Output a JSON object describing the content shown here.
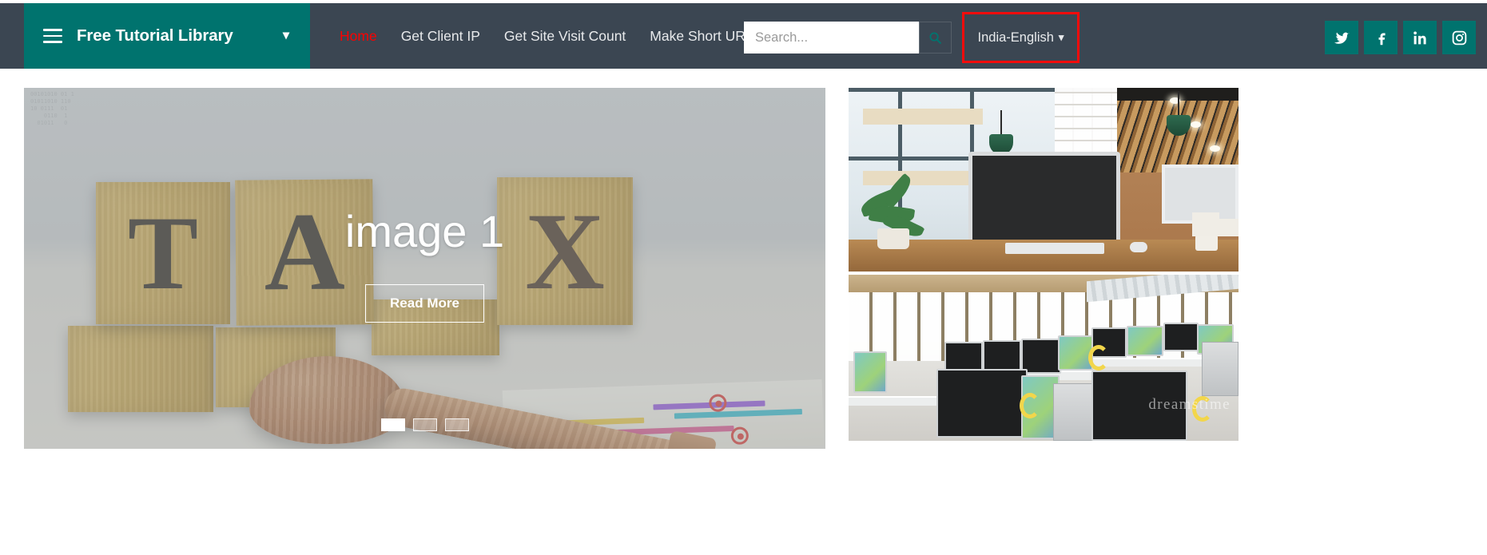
{
  "brand": {
    "title": "Free Tutorial Library",
    "menu_icon": "hamburger-icon",
    "caret_icon": "chevron-down-icon",
    "bg_color": "#00736e"
  },
  "header": {
    "bg_color": "#3b4652",
    "nav": [
      {
        "label": "Home",
        "active": true,
        "color": "#fb0000"
      },
      {
        "label": "Get Client IP",
        "active": false
      },
      {
        "label": "Get Site Visit Count",
        "active": false
      },
      {
        "label": "Make Short URL",
        "active": false
      }
    ],
    "search": {
      "placeholder": "Search...",
      "value": "",
      "button_icon": "search-icon",
      "icon_color": "#00736e"
    },
    "language": {
      "label": "India-English",
      "caret_icon": "chevron-down-icon",
      "highlight_color": "#f50c0c",
      "highlighted": true
    },
    "socials": [
      {
        "name": "twitter",
        "icon": "twitter-icon"
      },
      {
        "name": "facebook",
        "icon": "facebook-icon"
      },
      {
        "name": "linkedin",
        "icon": "linkedin-icon"
      },
      {
        "name": "instagram",
        "icon": "instagram-icon"
      }
    ],
    "social_bg_color": "#00736e"
  },
  "carousel": {
    "slide_title": "image 1",
    "read_more_label": "Read More",
    "indicator_count": 3,
    "active_indicator": 1,
    "image_alt": "tax wooden blocks with gavel",
    "letters": [
      "T",
      "A",
      "X"
    ],
    "code_ghost": "00101010 01 1\n01011010 110\n10 0111  01\n    0110  1\n  01011   0"
  },
  "right_column": {
    "photos": [
      {
        "name": "office-workspace-photo",
        "alt": "modern office with monitor, wooden slat ceiling and green pendant lamps"
      },
      {
        "name": "computer-lab-photo",
        "alt": "computer lab rows of monitors with headphones",
        "watermark": "dreamstime"
      }
    ]
  }
}
